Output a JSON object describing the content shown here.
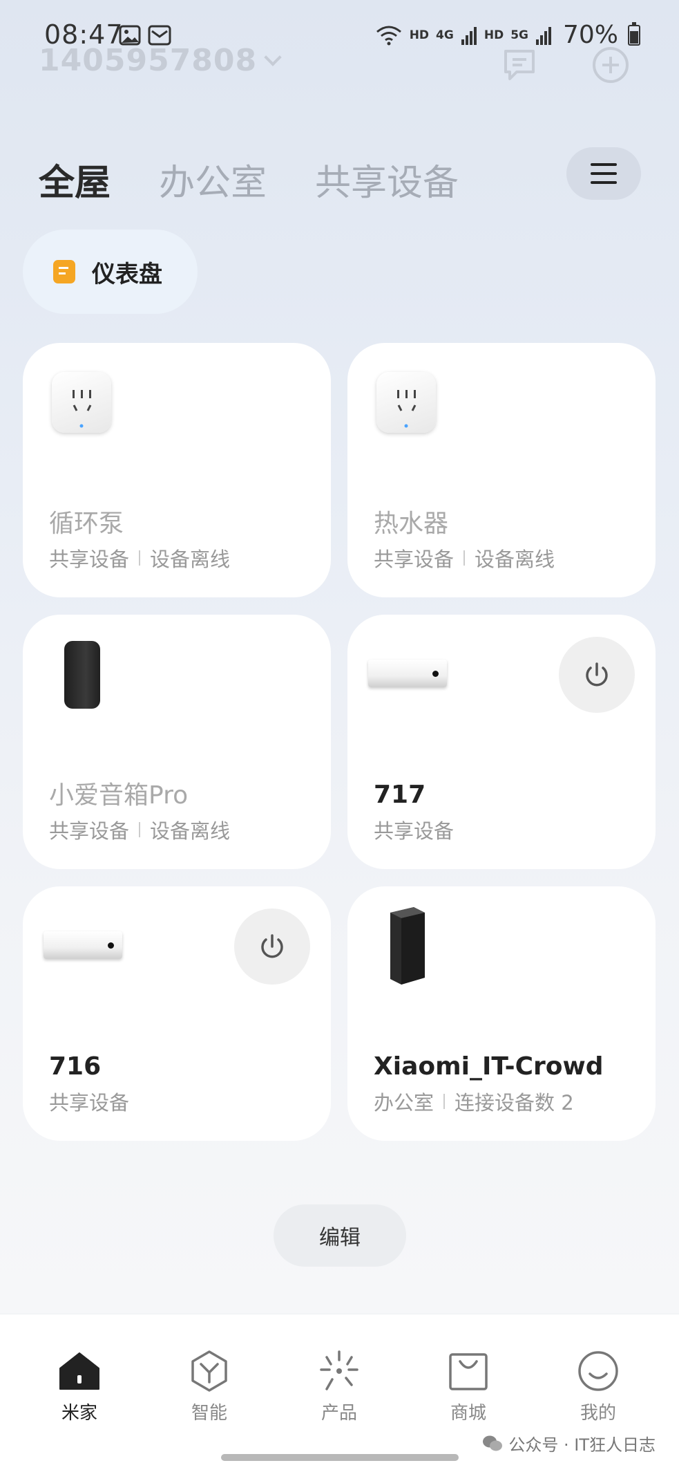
{
  "status_bar": {
    "time": "08:47",
    "net1": "HD",
    "net1_type": "4G",
    "net2": "HD",
    "net2_type": "5G",
    "battery": "70%"
  },
  "account": {
    "id": "1405957808"
  },
  "tabs": [
    {
      "label": "全屋",
      "active": true
    },
    {
      "label": "办公室",
      "active": false
    },
    {
      "label": "共享设备",
      "active": false
    }
  ],
  "dashboard": {
    "label": "仪表盘"
  },
  "devices": [
    {
      "name": "循环泵",
      "room": "共享设备",
      "status": "设备离线",
      "icon": "smart-plug-icon"
    },
    {
      "name": "热水器",
      "room": "共享设备",
      "status": "设备离线",
      "icon": "smart-plug-icon"
    },
    {
      "name": "小爱音箱Pro",
      "room": "共享设备",
      "status": "设备离线",
      "icon": "smart-speaker-icon"
    },
    {
      "name": "717",
      "room": "共享设备",
      "icon": "air-conditioner-icon"
    },
    {
      "name": "716",
      "room": "共享设备",
      "icon": "air-conditioner-icon"
    },
    {
      "name": "Xiaomi_IT-Crowd",
      "room": "办公室",
      "status": "连接设备数 2",
      "icon": "router-icon"
    }
  ],
  "edit": {
    "label": "编辑"
  },
  "nav": [
    {
      "label": "米家",
      "icon": "home-icon",
      "active": true
    },
    {
      "label": "智能",
      "icon": "smart-cube-icon"
    },
    {
      "label": "产品",
      "icon": "product-sparkle-icon"
    },
    {
      "label": "商城",
      "icon": "shopping-bag-icon"
    },
    {
      "label": "我的",
      "icon": "smiley-profile-icon"
    }
  ],
  "watermark": {
    "text": "公众号 · IT狂人日志"
  },
  "colors": {
    "background": "#e3e9f2",
    "card": "#ffffff",
    "dashboard_icon": "#f5a623",
    "offline_text": "#a9a9a9"
  }
}
